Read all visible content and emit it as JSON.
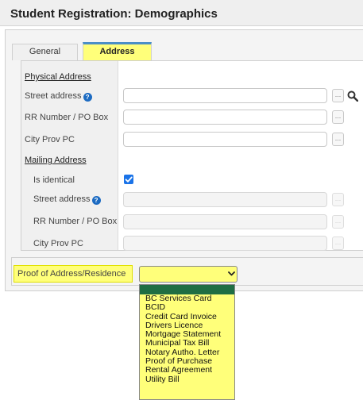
{
  "page": {
    "title": "Student Registration: Demographics"
  },
  "tabs": [
    {
      "label": "General",
      "active": false
    },
    {
      "label": "Address",
      "active": true
    }
  ],
  "physical": {
    "section_title": "Physical Address",
    "street_label": "Street address",
    "rr_label": "RR Number / PO Box",
    "city_label": "City Prov PC",
    "street_value": "",
    "rr_value": "",
    "city_value": ""
  },
  "mailing": {
    "section_title": "Mailing Address",
    "identical_label": "Is identical",
    "identical_checked": true,
    "street_label": "Street address",
    "rr_label": "RR Number / PO Box",
    "city_label": "City Prov PC"
  },
  "ellipsis": "...",
  "proof": {
    "label": "Proof of Address/Residence",
    "selected": "",
    "options": [
      "BC Services Card",
      "BCID",
      "Credit Card Invoice",
      "Drivers Licence",
      "Mortgage Statement",
      "Municipal Tax Bill",
      "Notary Autho. Letter",
      "Proof of Purchase",
      "Rental Agreement",
      "Utility Bill"
    ]
  },
  "colors": {
    "highlight": "#ffff7a",
    "accent_blue": "#1a73e8",
    "dropdown_header": "#1f6e43"
  },
  "icons": {
    "search": "search-icon",
    "help": "help-icon",
    "check": "checkmark-icon",
    "chevron": "chevron-down-icon"
  }
}
